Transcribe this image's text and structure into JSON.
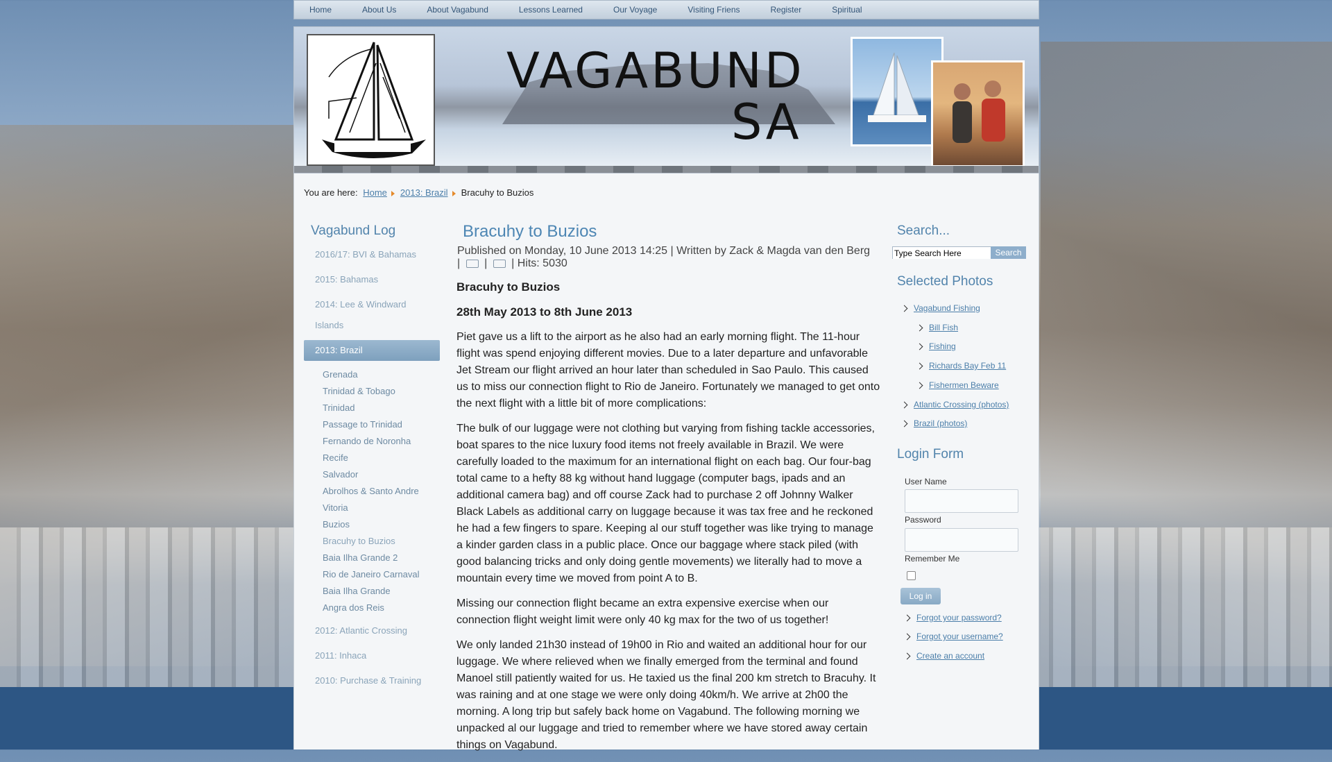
{
  "topnav": [
    "Home",
    "About Us",
    "About Vagabund",
    "Lessons Learned",
    "Our Voyage",
    "Visiting Friens",
    "Register",
    "Spiritual"
  ],
  "banner": {
    "brand_line1": "VAGABUND",
    "brand_line2": "SA"
  },
  "breadcrumb": {
    "prefix": "You are here:",
    "items": [
      "Home",
      "2013: Brazil"
    ],
    "current": "Bracuhy to Buzios"
  },
  "leftmenu": {
    "title": "Vagabund Log",
    "top_items": [
      "2016/17: BVI & Bahamas",
      "2015: Bahamas",
      "2014: Lee & Windward Islands",
      "2013: Brazil"
    ],
    "sub_items": [
      "Grenada",
      "Trinidad & Tobago",
      "Trinidad",
      "Passage to Trinidad",
      "Fernando de Noronha",
      "Recife",
      "Salvador",
      "Abrolhos & Santo Andre",
      "Vitoria",
      "Buzios",
      "Bracuhy to Buzios",
      "Baia Ilha Grande 2",
      "Rio de Janeiro Carnaval",
      "Baia Ilha Grande",
      "Angra dos Reis"
    ],
    "bottom_items": [
      "2012: Atlantic Crossing",
      "2011: Inhaca",
      "2010: Purchase & Training"
    ]
  },
  "article": {
    "title": "Bracuhy to Buzios",
    "meta_line1": "Published on Monday, 10 June 2013 14:25 | Written by Zack & Magda van den Berg",
    "hits": "| Hits: 5030",
    "heading": "Bracuhy to Buzios",
    "dates": "28th May 2013 to 8th June 2013",
    "p1": "Piet gave us a lift to the airport as he also had an early morning flight. The 11-hour flight was spend enjoying different movies. Due to a later departure and unfavorable Jet Stream our flight arrived an hour later than scheduled in Sao Paulo. This caused us to miss our connection flight to Rio de Janeiro. Fortunately we managed to get onto the next flight with a little bit of more complications:",
    "p2": "The bulk of our luggage were not clothing but varying from fishing tackle accessories, boat spares to the nice luxury food items not freely available in Brazil. We were carefully loaded to the maximum for an international flight on each bag. Our four-bag total came to a hefty 88 kg without hand luggage (computer bags, ipads and an additional camera bag) and off course Zack had to purchase 2 off Johnny Walker Black Labels as additional carry on luggage because it was tax free and he reckoned he had a few fingers to spare. Keeping al our stuff together was like trying to manage a kinder garden class in a public place. Once our baggage where stack piled (with good balancing tricks and only doing gentle movements) we literally had to move a mountain every time we moved from point A to B.",
    "p3": "Missing our connection flight became an extra expensive exercise when our connection flight weight limit were only 40 kg max for the two of us together!",
    "p4": "We only landed 21h30 instead of 19h00 in Rio and waited an additional hour for our luggage. We where relieved when we finally emerged from the terminal and found Manoel still patiently waited for us. He taxied us the final 200 km stretch to Bracuhy. It was raining and at one stage we were only doing 40km/h. We arrive at 2h00 the morning. A long trip but safely back home on Vagabund. The following morning we unpacked al our luggage and tried to remember where we have stored away certain things on Vagabund."
  },
  "search": {
    "title": "Search...",
    "placeholder": "Type Search Here",
    "button": "Search"
  },
  "selected_photos": {
    "title": "Selected Photos",
    "items": [
      "Vagabund Fishing",
      "Bill Fish",
      "Fishing",
      "Richards Bay Feb 11",
      "Fishermen Beware",
      "Atlantic Crossing (photos)",
      "Brazil (photos)"
    ]
  },
  "login": {
    "title": "Login Form",
    "username_label": "User Name",
    "password_label": "Password",
    "remember_label": "Remember Me",
    "button": "Log in",
    "links": [
      "Forgot your password?",
      "Forgot your username?",
      "Create an account"
    ]
  }
}
